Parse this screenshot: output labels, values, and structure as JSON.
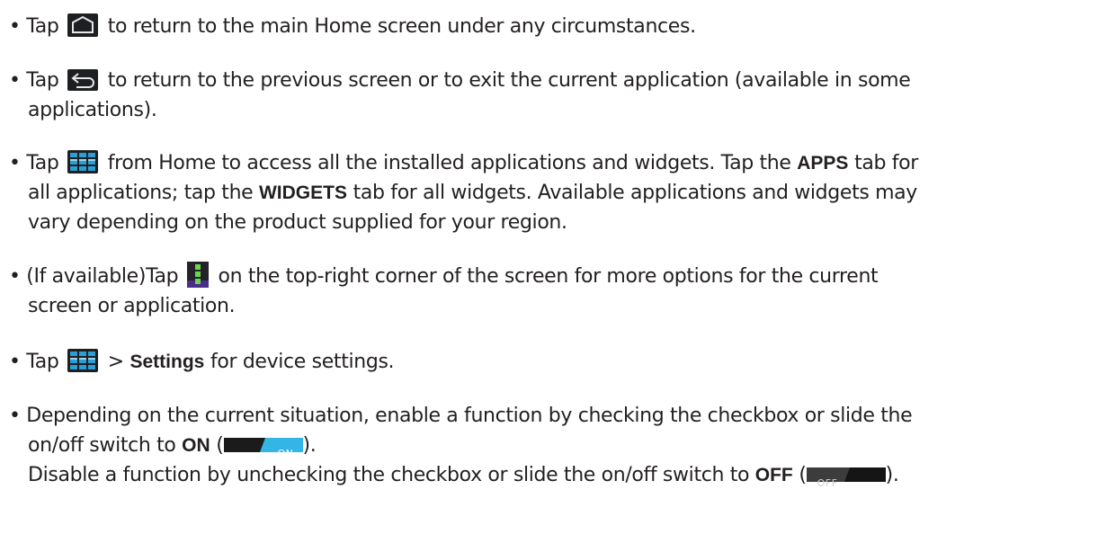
{
  "items": [
    {
      "lines": [
        {
          "pre": "• Tap ",
          "icon": "home-icon",
          "post": " to return to the main Home screen under any circumstances."
        }
      ]
    },
    {
      "lines": [
        {
          "pre": "• Tap ",
          "icon": "back-icon",
          "post": " to return to the previous screen or to exit the current application (available in some"
        },
        {
          "text": "applications)."
        }
      ]
    },
    {
      "lines": [
        {
          "pre": "• Tap ",
          "icon": "all-apps-grid-icon",
          "post1": " from Home to access all the installed applications and widgets. Tap the ",
          "bold1": "APPS",
          "post2": " tab for"
        },
        {
          "text1": "all applications; tap the ",
          "bold1": "WIDGETS",
          "text2": " tab for all widgets. Available applications and widgets may"
        },
        {
          "text": "vary depending on the product supplied for your region."
        }
      ]
    },
    {
      "lines": [
        {
          "pre": "• (If available)Tap ",
          "icon": "menu-overflow-icon",
          "post": " on the top-right corner of the screen for more options for the current"
        },
        {
          "text": "screen or application."
        }
      ]
    },
    {
      "lines": [
        {
          "pre": "• Tap ",
          "icon": "all-apps-grid-icon",
          "post1": " > ",
          "bold1": "Settings",
          "post2": " for device settings."
        }
      ]
    },
    {
      "lines": [
        {
          "text": "• Depending on the current situation, enable a function by checking the checkbox or slide the"
        },
        {
          "text1": "on/off switch to ",
          "bold1": "ON",
          "text2": " (",
          "switch_label": "ON",
          "text3": ")."
        },
        {
          "text1": "Disable a function by unchecking the checkbox or slide the on/off switch to ",
          "bold1": "OFF",
          "text2": " (",
          "switch_label": "OFF",
          "text3": ")."
        }
      ]
    }
  ],
  "colors": {
    "text": "#231f20",
    "icon_bg": "#1e1f22",
    "grid_blue": "#2a9fd6",
    "switch_on": "#33b5e5",
    "switch_off_bg": "#3c3c3c"
  }
}
